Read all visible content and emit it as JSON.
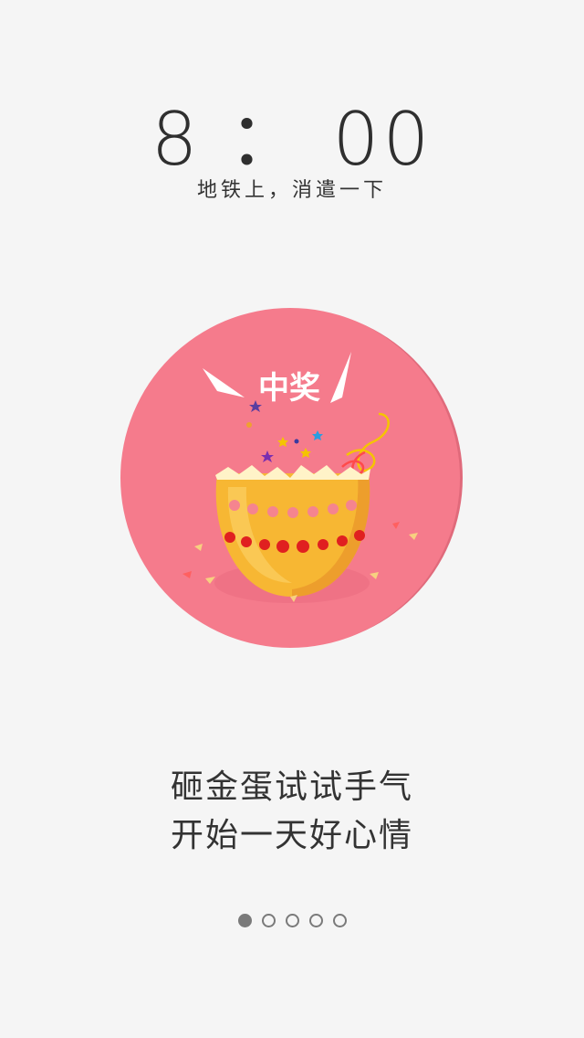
{
  "clock": {
    "hour": "8",
    "separator": "：",
    "minute": "00"
  },
  "caption": "地铁上，消遣一下",
  "illustration": {
    "badge_text": "中奖",
    "icon": "golden-egg-icon",
    "circle_color": "#f47a8a",
    "egg_color": "#f7b733"
  },
  "headline": {
    "line1": "砸金蛋试试手气",
    "line2": "开始一天好心情"
  },
  "pager": {
    "total": 5,
    "active_index": 0
  }
}
